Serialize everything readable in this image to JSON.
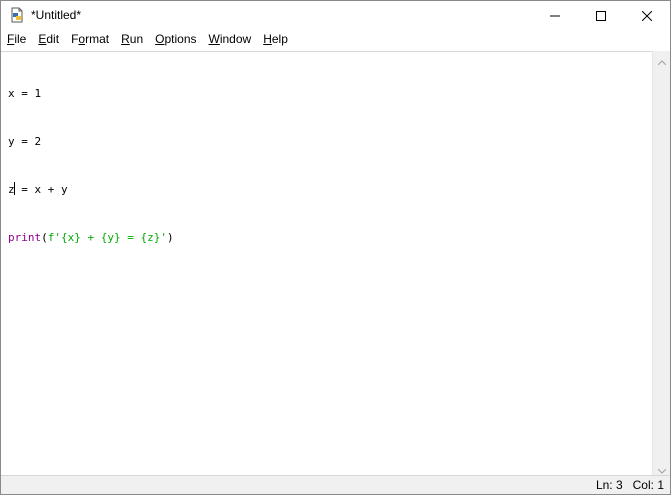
{
  "window": {
    "title": "*Untitled*",
    "icon": "idle-python-file-icon",
    "controls": {
      "minimize": "minimize-icon",
      "maximize": "maximize-icon",
      "close": "close-icon"
    }
  },
  "menubar": {
    "items": [
      {
        "label": "File",
        "accel": "F",
        "rest": "ile"
      },
      {
        "label": "Edit",
        "accel": "E",
        "rest": "dit"
      },
      {
        "label": "Format",
        "accel": "o",
        "pre": "F",
        "rest": "rmat"
      },
      {
        "label": "Run",
        "accel": "R",
        "rest": "un"
      },
      {
        "label": "Options",
        "accel": "O",
        "rest": "ptions"
      },
      {
        "label": "Window",
        "accel": "W",
        "rest": "indow"
      },
      {
        "label": "Help",
        "accel": "H",
        "rest": "elp"
      }
    ]
  },
  "editor": {
    "lines": [
      "x = 1",
      "y = 2",
      "z = x + y",
      "print(f'{x} + {y} = {z}')"
    ],
    "line1": "x = 1",
    "line2": "y = 2",
    "line3_before_caret": "z",
    "line3_after_caret": " = x + y",
    "line4_builtin": "print",
    "line4_paren_open": "(",
    "line4_string": "f'{x} + {y} = {z}'",
    "line4_paren_close": ")",
    "colors": {
      "builtin": "#900090",
      "string": "#00aa00",
      "default": "#000000"
    }
  },
  "statusbar": {
    "line": "Ln: 3",
    "col": "Col: 1"
  }
}
